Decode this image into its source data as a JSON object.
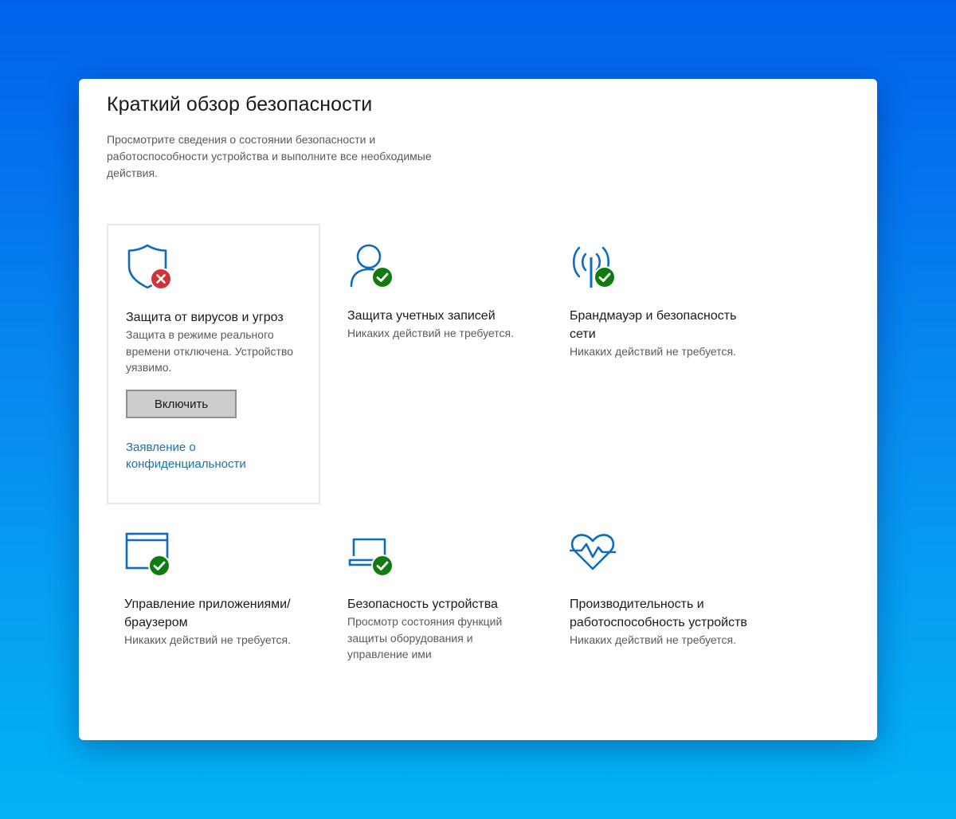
{
  "header": {
    "title": "Краткий обзор безопасности",
    "description": "Просмотрите сведения о состоянии безопасности и работоспособности устройства и выполните все необходимые действия."
  },
  "colors": {
    "accent": "#0f6cbd",
    "ok": "#107c10",
    "error": "#d13438",
    "link": "#1a73a8"
  },
  "tiles": [
    {
      "icon": "shield-icon",
      "status": "error",
      "title": "Защита от вирусов и угроз",
      "subtitle": "Защита в режиме реального времени отключена. Устройство уязвимо.",
      "button_label": "Включить",
      "link_label": "Заявление о конфиденциальности"
    },
    {
      "icon": "person-icon",
      "status": "ok",
      "title": "Защита учетных записей",
      "subtitle": "Никаких действий не требуется."
    },
    {
      "icon": "wireless-antenna-icon",
      "status": "ok",
      "title": "Брандмауэр и безопасность сети",
      "subtitle": "Никаких действий не требуется."
    },
    {
      "icon": "app-browser-window-icon",
      "status": "ok",
      "title": "Управление приложениями/браузером",
      "subtitle": "Никаких действий не требуется."
    },
    {
      "icon": "laptop-icon",
      "status": "ok",
      "title": "Безопасность устройства",
      "subtitle": "Просмотр состояния функций защиты оборудования и управление ими"
    },
    {
      "icon": "heart-pulse-icon",
      "status": "ok",
      "title": "Производительность и работоспособность устройств",
      "subtitle": "Никаких действий не требуется."
    }
  ]
}
